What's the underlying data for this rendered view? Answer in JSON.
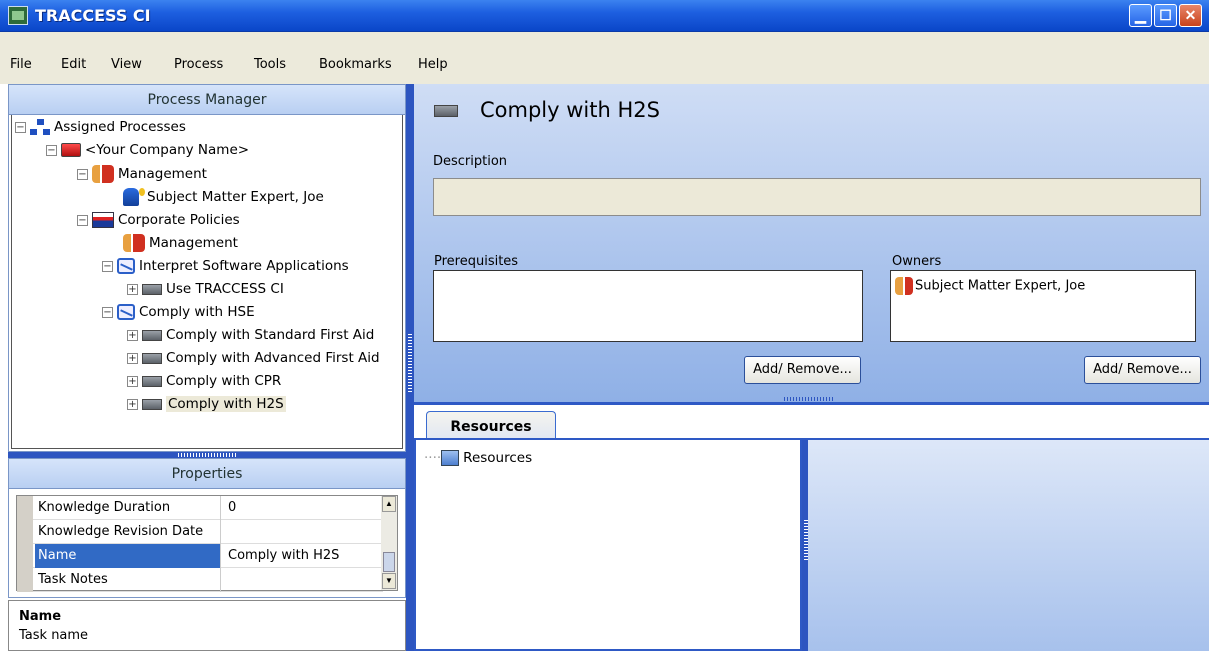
{
  "window": {
    "title": "TRACCESS CI",
    "minimize_icon": "minimize-icon",
    "maximize_icon": "maximize-icon",
    "close_icon": "close-icon"
  },
  "menu": [
    "File",
    "Edit",
    "View",
    "Process",
    "Tools",
    "Bookmarks",
    "Help"
  ],
  "process_manager": {
    "title": "Process Manager",
    "tree": [
      {
        "label": "Assigned Processes",
        "icon": "org-chart-icon",
        "expander": "−"
      },
      {
        "label": "<Your Company Name>",
        "icon": "company-icon",
        "expander": "−"
      },
      {
        "label": "Management",
        "icon": "group-icon",
        "expander": "−"
      },
      {
        "label": "Subject Matter Expert, Joe",
        "icon": "person-icon",
        "expander": ""
      },
      {
        "label": "Corporate Policies",
        "icon": "policy-icon",
        "expander": "−"
      },
      {
        "label": "Management",
        "icon": "group-icon",
        "expander": ""
      },
      {
        "label": "Interpret Software Applications",
        "icon": "process-icon",
        "expander": "−"
      },
      {
        "label": "Use TRACCESS CI",
        "icon": "task-icon",
        "expander": "+"
      },
      {
        "label": "Comply with HSE",
        "icon": "process-icon",
        "expander": "−"
      },
      {
        "label": "Comply with Standard First Aid",
        "icon": "task-icon",
        "expander": "+"
      },
      {
        "label": "Comply with Advanced First Aid",
        "icon": "task-icon",
        "expander": "+"
      },
      {
        "label": "Comply with CPR",
        "icon": "task-icon",
        "expander": "+"
      },
      {
        "label": "Comply with H2S",
        "icon": "task-icon",
        "expander": "+",
        "selected": true
      }
    ]
  },
  "properties": {
    "title": "Properties",
    "rows": [
      {
        "name": "Knowledge Duration",
        "value": "0"
      },
      {
        "name": "Knowledge Revision Date",
        "value": ""
      },
      {
        "name": "Name",
        "value": "Comply with H2S",
        "selected": true
      },
      {
        "name": "Task Notes",
        "value": ""
      }
    ],
    "description_name": "Name",
    "description_text": "Task name"
  },
  "detail": {
    "title": "Comply with H2S",
    "description_label": "Description",
    "description_value": "",
    "prerequisites_label": "Prerequisites",
    "owners_label": "Owners",
    "owners": [
      "Subject Matter Expert, Joe"
    ],
    "add_remove_label": "Add/ Remove..."
  },
  "resources": {
    "tab_label": "Resources",
    "tree": [
      "Resources"
    ]
  }
}
